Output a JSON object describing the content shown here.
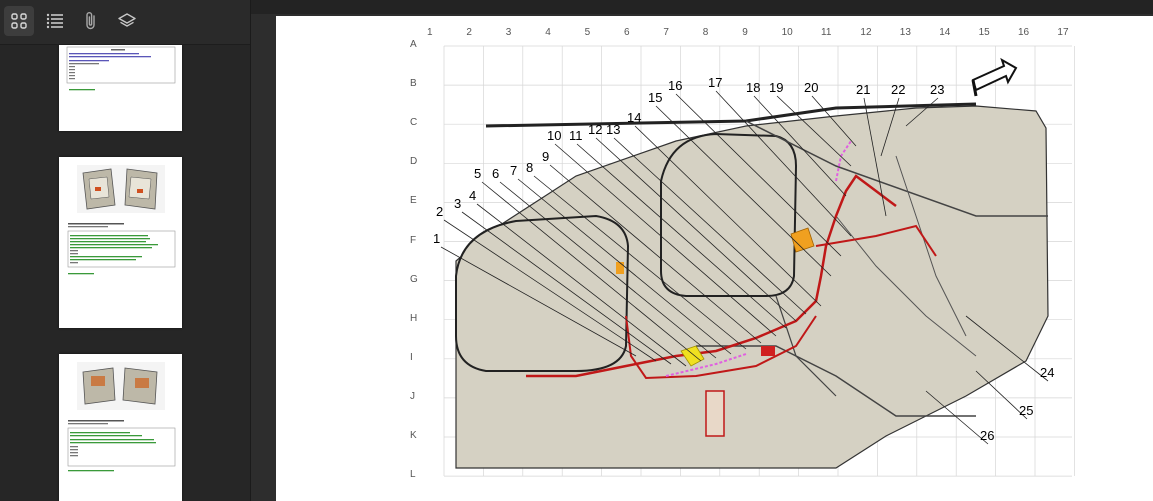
{
  "toolbar": {
    "icons": [
      "thumbnails-icon",
      "outline-icon",
      "attachments-icon",
      "layers-icon"
    ]
  },
  "diagram": {
    "columns": [
      "1",
      "2",
      "3",
      "4",
      "5",
      "6",
      "7",
      "8",
      "9",
      "10",
      "11",
      "12",
      "13",
      "14",
      "15",
      "16",
      "17"
    ],
    "rows": [
      "A",
      "B",
      "C",
      "D",
      "E",
      "F",
      "G",
      "H",
      "I",
      "J",
      "K",
      "L"
    ],
    "callouts": [
      {
        "n": "1"
      },
      {
        "n": "2"
      },
      {
        "n": "3"
      },
      {
        "n": "4"
      },
      {
        "n": "5"
      },
      {
        "n": "6"
      },
      {
        "n": "7"
      },
      {
        "n": "8"
      },
      {
        "n": "9"
      },
      {
        "n": "10"
      },
      {
        "n": "11"
      },
      {
        "n": "12"
      },
      {
        "n": "13"
      },
      {
        "n": "14"
      },
      {
        "n": "15"
      },
      {
        "n": "16"
      },
      {
        "n": "17"
      },
      {
        "n": "18"
      },
      {
        "n": "19"
      },
      {
        "n": "20"
      },
      {
        "n": "21"
      },
      {
        "n": "22"
      },
      {
        "n": "23"
      },
      {
        "n": "24"
      },
      {
        "n": "25"
      },
      {
        "n": "26"
      }
    ]
  }
}
